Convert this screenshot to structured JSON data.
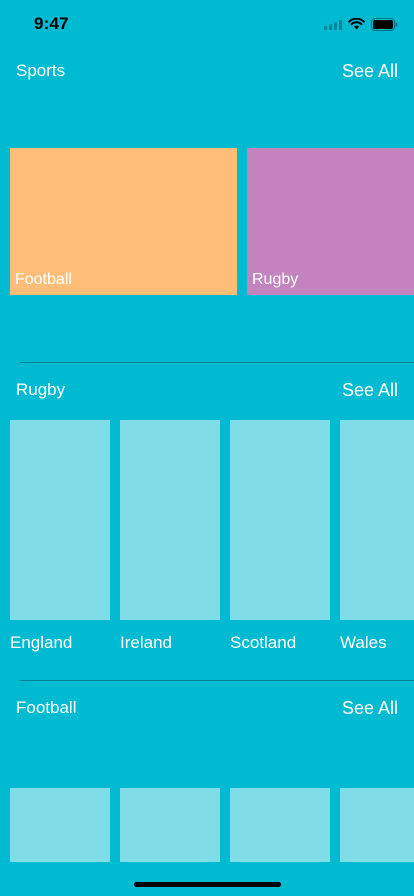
{
  "status_bar": {
    "time": "9:47",
    "icons": [
      "cellular-signal-icon",
      "wifi-icon",
      "battery-icon"
    ]
  },
  "colors": {
    "background": "#00BAD2",
    "football_card": "#FFBE78",
    "rugby_card": "#C383BE",
    "tile": "#80DDE8"
  },
  "sections": [
    {
      "title": "Sports",
      "see_all": "See All",
      "cards": [
        {
          "label": "Football"
        },
        {
          "label": "Rugby"
        }
      ]
    },
    {
      "title": "Rugby",
      "see_all": "See All",
      "items": [
        {
          "label": "England"
        },
        {
          "label": "Ireland"
        },
        {
          "label": "Scotland"
        },
        {
          "label": "Wales"
        }
      ]
    },
    {
      "title": "Football",
      "see_all": "See All",
      "items": [
        {
          "label": ""
        },
        {
          "label": ""
        },
        {
          "label": ""
        },
        {
          "label": ""
        }
      ]
    }
  ]
}
